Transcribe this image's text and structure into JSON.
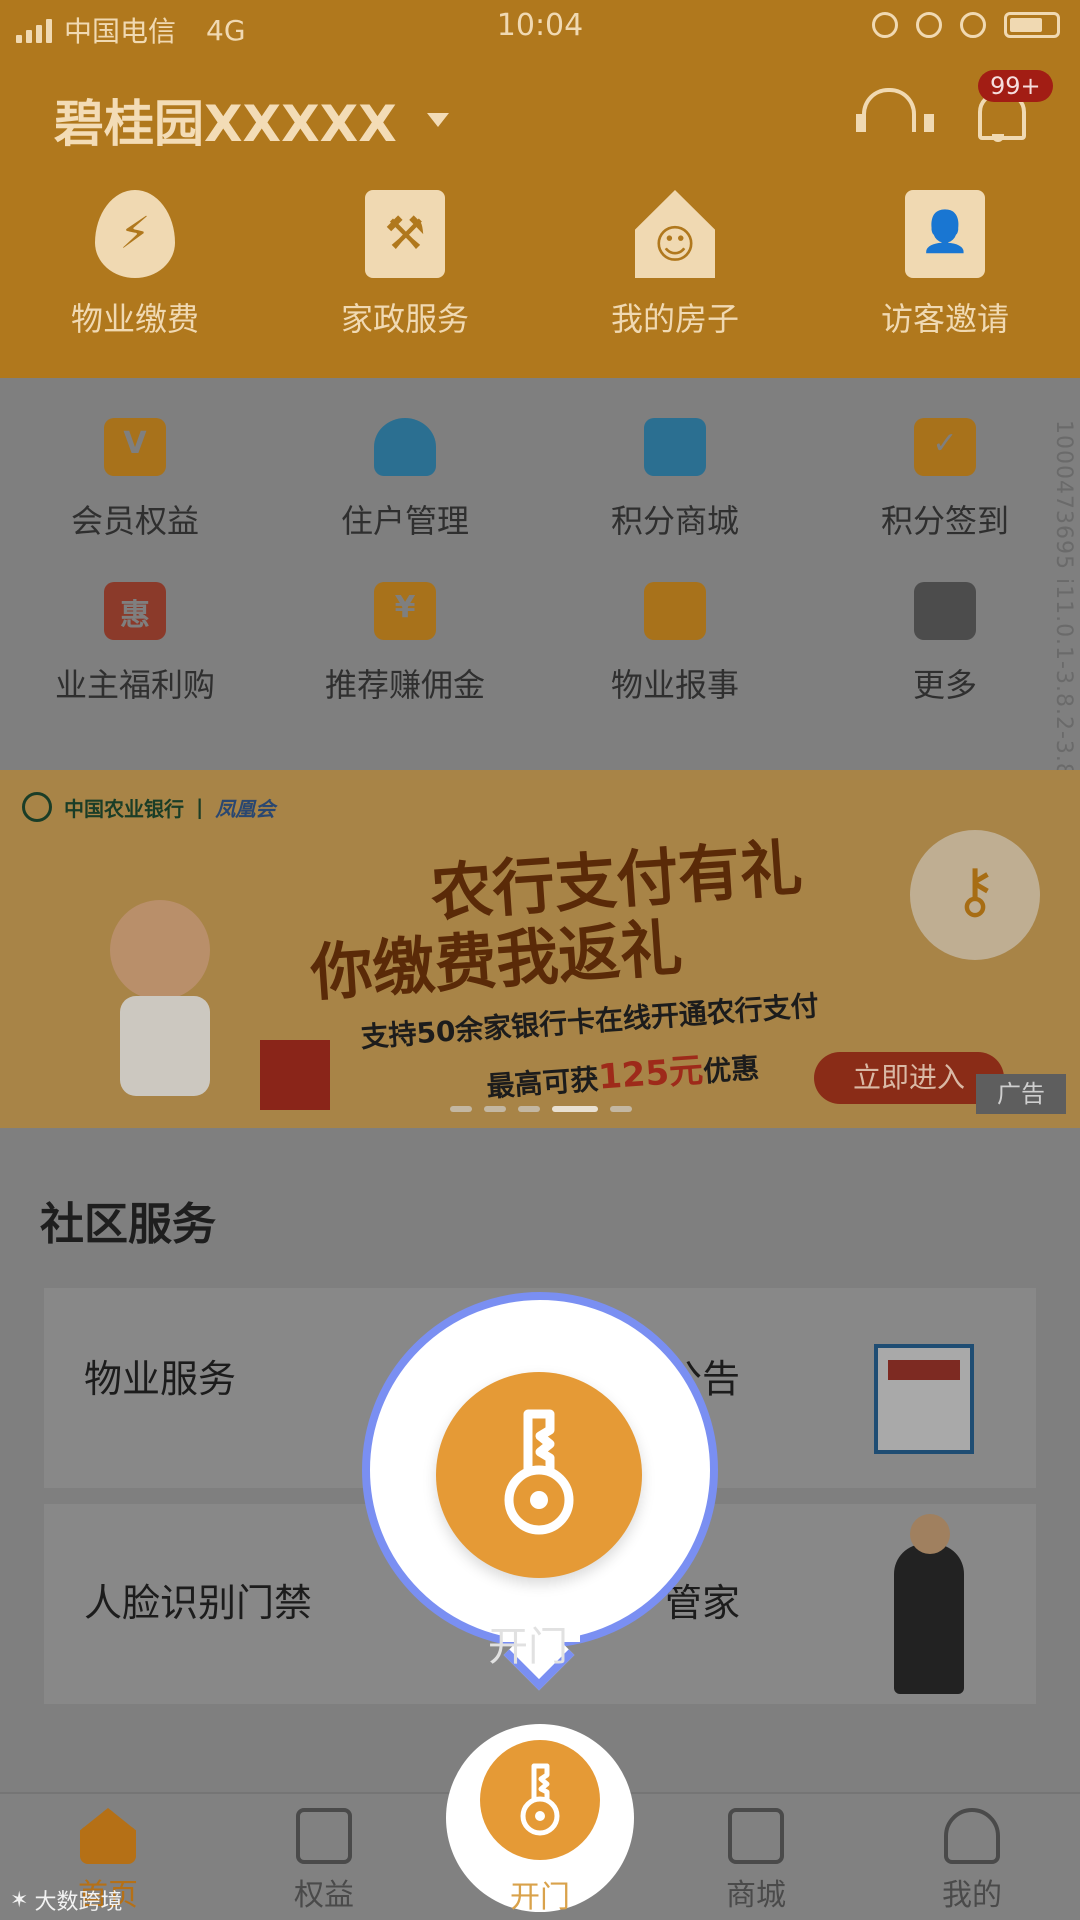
{
  "status_bar": {
    "carrier": "中国电信",
    "network": "4G",
    "time": "10:04"
  },
  "header": {
    "community_name": "碧桂园XXXXX",
    "notification_badge": "99+"
  },
  "top_grid": [
    {
      "label": "物业缴费",
      "icon": "bolt-drop-icon"
    },
    {
      "label": "家政服务",
      "icon": "broom-icon"
    },
    {
      "label": "我的房子",
      "icon": "house-icon"
    },
    {
      "label": "访客邀请",
      "icon": "visitor-badge-icon"
    }
  ],
  "second_grid": [
    {
      "label": "会员权益",
      "icon": "crown-icon",
      "glyph": "V"
    },
    {
      "label": "住户管理",
      "icon": "users-icon",
      "glyph": ""
    },
    {
      "label": "积分商城",
      "icon": "gift-icon",
      "glyph": ""
    },
    {
      "label": "积分签到",
      "icon": "calendar-check-icon",
      "glyph": "✓"
    },
    {
      "label": "业主福利购",
      "icon": "shopping-bag-icon",
      "glyph": "惠"
    },
    {
      "label": "推荐赚佣金",
      "icon": "yen-icon",
      "glyph": "¥"
    },
    {
      "label": "物业报事",
      "icon": "edit-note-icon",
      "glyph": ""
    },
    {
      "label": "更多",
      "icon": "more-grid-icon",
      "glyph": ""
    }
  ],
  "side_text": "1000473695 i11.0.1-3.8.2-3.8.2",
  "banner": {
    "bank_name": "中国农业银行",
    "partner": "凤凰会",
    "title_line1": "农行支付有礼",
    "title_line2": "你缴费我返礼",
    "desc_line1": "支持50余家银行卡在线开通农行支付",
    "desc_prefix": "最高可获",
    "desc_highlight": "125元",
    "desc_suffix": "优惠",
    "cta": "立即进入",
    "ad_tag": "广告"
  },
  "community_services": {
    "title": "社区服务",
    "cards": [
      {
        "left": "物业服务",
        "right": "公告"
      },
      {
        "left": "人脸识别门禁",
        "right": "管家"
      }
    ]
  },
  "highlight": {
    "faded_label": "开门"
  },
  "bottom_nav": [
    {
      "label": "首页",
      "icon": "home-icon"
    },
    {
      "label": "权益",
      "icon": "crown-icon"
    },
    {
      "label": "开门",
      "icon": "key-icon"
    },
    {
      "label": "商城",
      "icon": "shopping-bag-icon"
    },
    {
      "label": "我的",
      "icon": "user-icon"
    }
  ],
  "watermark": "大数跨境",
  "colors": {
    "accent": "#e59a36",
    "highlight_ring": "#7a8ff2"
  }
}
